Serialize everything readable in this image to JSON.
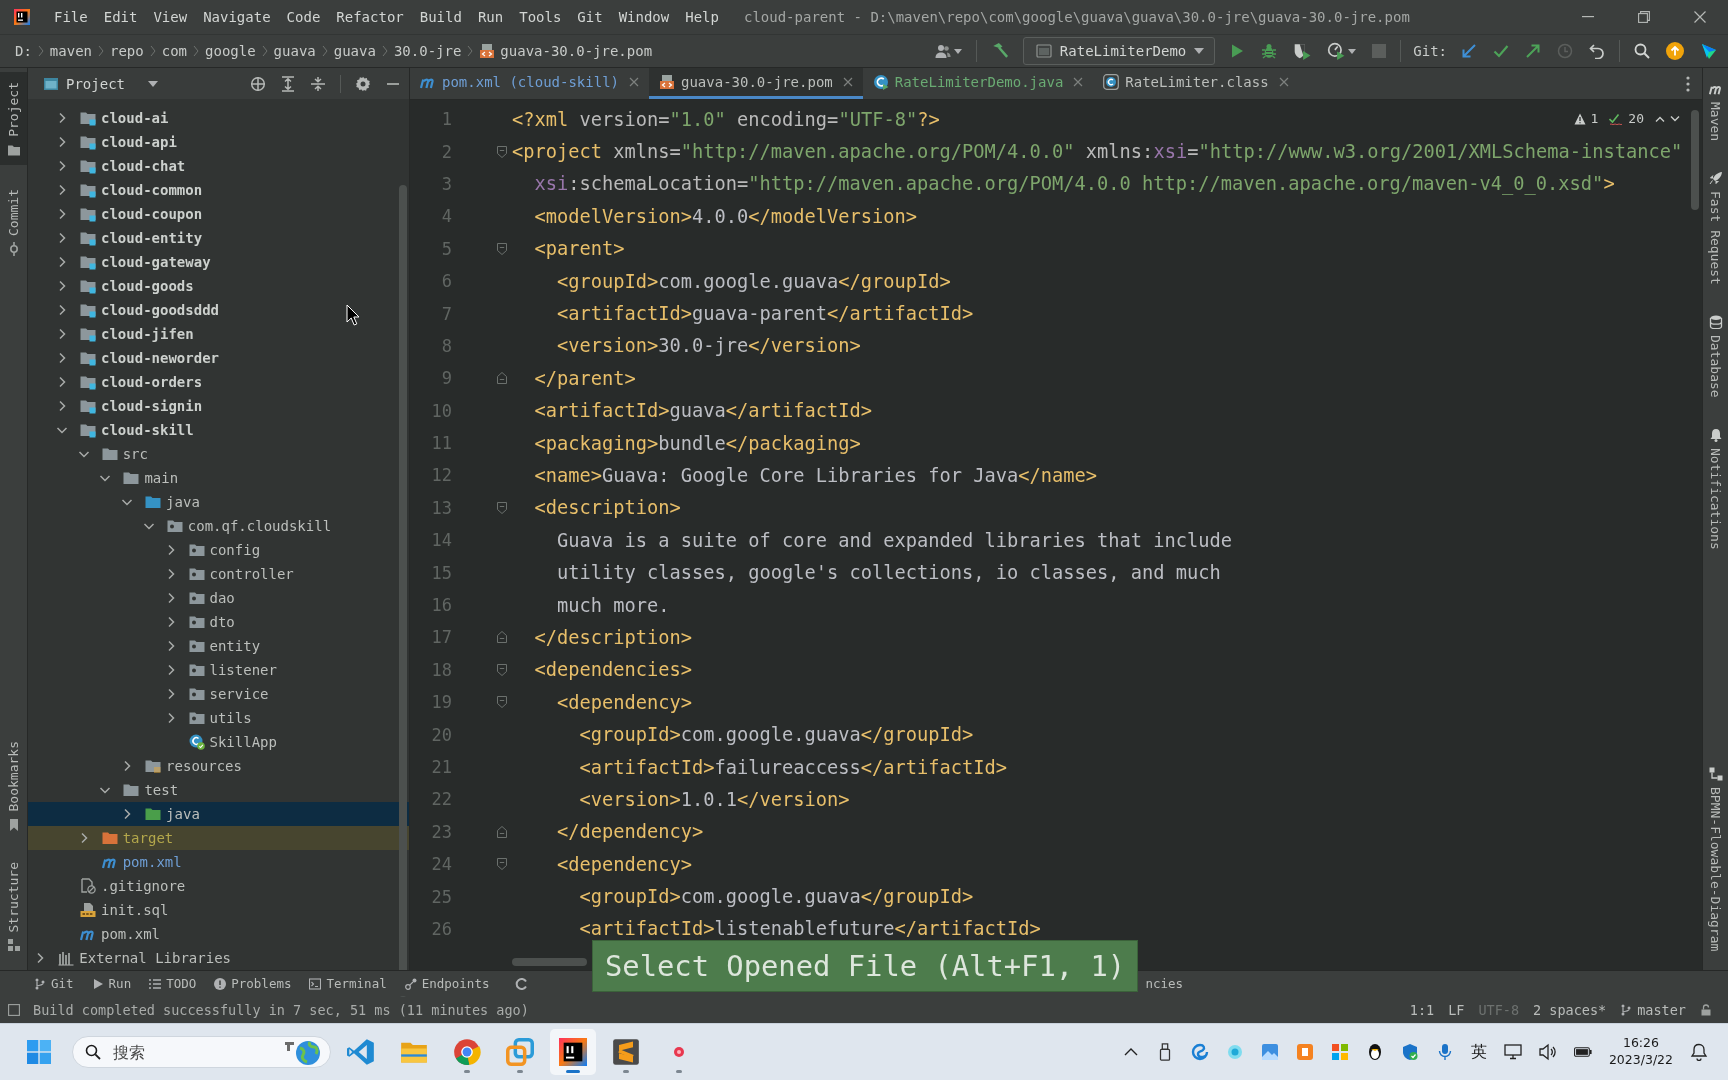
{
  "window": {
    "title": "cloud-parent - D:\\maven\\repo\\com\\google\\guava\\guava\\30.0-jre\\guava-30.0-jre.pom"
  },
  "menu": [
    "File",
    "Edit",
    "View",
    "Navigate",
    "Code",
    "Refactor",
    "Build",
    "Run",
    "Tools",
    "Git",
    "Window",
    "Help"
  ],
  "breadcrumb": [
    "D:",
    "maven",
    "repo",
    "com",
    "google",
    "guava",
    "guava",
    "30.0-jre",
    "guava-30.0-jre.pom"
  ],
  "toolbar": {
    "run_configuration": "RateLimiterDemo",
    "stop": {
      "disabled": true
    },
    "git_label": "Git:",
    "git_history": {
      "disabled": true
    }
  },
  "left_stripe": {
    "top": [
      {
        "label": "Project",
        "selected": true
      },
      {
        "label": "Commit",
        "selected": false
      }
    ],
    "bottom": [
      {
        "label": "Bookmarks",
        "selected": false
      },
      {
        "label": "Structure",
        "selected": false
      }
    ]
  },
  "project_panel": {
    "title": "Project",
    "tree": [
      {
        "label": "cloud-ai",
        "kind": "module",
        "expanded": false,
        "selected": false
      },
      {
        "label": "cloud-api",
        "kind": "module",
        "expanded": false,
        "selected": false
      },
      {
        "label": "cloud-chat",
        "kind": "module",
        "expanded": false,
        "selected": false
      },
      {
        "label": "cloud-common",
        "kind": "module",
        "expanded": false,
        "selected": false
      },
      {
        "label": "cloud-coupon",
        "kind": "module",
        "expanded": false,
        "selected": false
      },
      {
        "label": "cloud-entity",
        "kind": "module",
        "expanded": false,
        "selected": false
      },
      {
        "label": "cloud-gateway",
        "kind": "module",
        "expanded": false,
        "selected": false
      },
      {
        "label": "cloud-goods",
        "kind": "module",
        "expanded": false,
        "selected": false
      },
      {
        "label": "cloud-goodsddd",
        "kind": "module",
        "expanded": false,
        "selected": false
      },
      {
        "label": "cloud-jifen",
        "kind": "module",
        "expanded": false,
        "selected": false
      },
      {
        "label": "cloud-neworder",
        "kind": "module",
        "expanded": false,
        "selected": false
      },
      {
        "label": "cloud-orders",
        "kind": "module",
        "expanded": false,
        "selected": false
      },
      {
        "label": "cloud-signin",
        "kind": "module",
        "expanded": false,
        "selected": false
      },
      {
        "label": "cloud-skill",
        "kind": "module",
        "expanded": true,
        "selected": false,
        "children": [
          {
            "label": "src",
            "kind": "folder",
            "expanded": true,
            "selected": false,
            "children": [
              {
                "label": "main",
                "kind": "folder",
                "expanded": true,
                "selected": false,
                "children": [
                  {
                    "label": "java",
                    "kind": "source",
                    "expanded": true,
                    "selected": false,
                    "children": [
                      {
                        "label": "com.qf.cloudskill",
                        "kind": "package",
                        "expanded": true,
                        "selected": false,
                        "children": [
                          {
                            "label": "config",
                            "kind": "package",
                            "expanded": false,
                            "selected": false
                          },
                          {
                            "label": "controller",
                            "kind": "package",
                            "expanded": false,
                            "selected": false
                          },
                          {
                            "label": "dao",
                            "kind": "package",
                            "expanded": false,
                            "selected": false
                          },
                          {
                            "label": "dto",
                            "kind": "package",
                            "expanded": false,
                            "selected": false
                          },
                          {
                            "label": "entity",
                            "kind": "package",
                            "expanded": false,
                            "selected": false
                          },
                          {
                            "label": "listener",
                            "kind": "package",
                            "expanded": false,
                            "selected": false
                          },
                          {
                            "label": "service",
                            "kind": "package",
                            "expanded": false,
                            "selected": false
                          },
                          {
                            "label": "utils",
                            "kind": "package",
                            "expanded": false,
                            "selected": false
                          },
                          {
                            "label": "SkillApp",
                            "kind": "spring_class",
                            "modified": false,
                            "selected": false
                          }
                        ]
                      }
                    ]
                  },
                  {
                    "label": "resources",
                    "kind": "resources",
                    "expanded": false,
                    "selected": false
                  }
                ]
              },
              {
                "label": "test",
                "kind": "folder",
                "expanded": true,
                "selected": false,
                "children": [
                  {
                    "label": "java",
                    "kind": "test_source",
                    "expanded": false,
                    "selected": true
                  }
                ]
              }
            ]
          },
          {
            "label": "target",
            "kind": "excluded",
            "expanded": false,
            "selected": false
          },
          {
            "label": "pom.xml",
            "kind": "maven",
            "modified": true,
            "selected": false
          }
        ]
      },
      {
        "label": ".gitignore",
        "kind": "ignore",
        "modified": false,
        "selected": false
      },
      {
        "label": "init.sql",
        "kind": "sql",
        "modified": false,
        "selected": false
      },
      {
        "label": "pom.xml",
        "kind": "maven",
        "modified": false,
        "selected": false
      }
    ],
    "outer_items": [
      {
        "label": "External Libraries",
        "kind": "libraries",
        "expanded": false,
        "selected": false
      }
    ]
  },
  "editor_tabs": [
    {
      "label": "pom.xml (cloud-skill)",
      "kind": "maven",
      "modified": true,
      "added": false,
      "selected": false
    },
    {
      "label": "guava-30.0-jre.pom",
      "kind": "xml",
      "modified": false,
      "added": false,
      "selected": true
    },
    {
      "label": "RateLimiterDemo.java",
      "kind": "class",
      "modified": false,
      "added": true,
      "selected": false
    },
    {
      "label": "RateLimiter.class",
      "kind": "compiled",
      "modified": false,
      "added": false,
      "selected": false
    }
  ],
  "editor": {
    "inspections": {
      "warnings": "1",
      "passed": "20"
    },
    "lines": [
      {
        "number": "1",
        "text": "<?xml version=\"1.0\" encoding=\"UTF-8\"?>"
      },
      {
        "number": "2",
        "text": "<project xmlns=\"http://maven.apache.org/POM/4.0.0\" xmlns:xsi=\"http://www.w3.org/2001/XMLSchema-instance\""
      },
      {
        "number": "3",
        "text": "  xsi:schemaLocation=\"http://maven.apache.org/POM/4.0.0 http://maven.apache.org/maven-v4_0_0.xsd\">"
      },
      {
        "number": "4",
        "text": "  <modelVersion>4.0.0</modelVersion>"
      },
      {
        "number": "5",
        "text": "  <parent>"
      },
      {
        "number": "6",
        "text": "    <groupId>com.google.guava</groupId>"
      },
      {
        "number": "7",
        "text": "    <artifactId>guava-parent</artifactId>"
      },
      {
        "number": "8",
        "text": "    <version>30.0-jre</version>"
      },
      {
        "number": "9",
        "text": "  </parent>"
      },
      {
        "number": "10",
        "text": "  <artifactId>guava</artifactId>"
      },
      {
        "number": "11",
        "text": "  <packaging>bundle</packaging>"
      },
      {
        "number": "12",
        "text": "  <name>Guava: Google Core Libraries for Java</name>"
      },
      {
        "number": "13",
        "text": "  <description>"
      },
      {
        "number": "14",
        "text": "    Guava is a suite of core and expanded libraries that include"
      },
      {
        "number": "15",
        "text": "    utility classes, google's collections, io classes, and much"
      },
      {
        "number": "16",
        "text": "    much more."
      },
      {
        "number": "17",
        "text": "  </description>"
      },
      {
        "number": "18",
        "text": "  <dependencies>"
      },
      {
        "number": "19",
        "text": "    <dependency>"
      },
      {
        "number": "20",
        "text": "      <groupId>com.google.guava</groupId>"
      },
      {
        "number": "21",
        "text": "      <artifactId>failureaccess</artifactId>"
      },
      {
        "number": "22",
        "text": "      <version>1.0.1</version>"
      },
      {
        "number": "23",
        "text": "    </dependency>"
      },
      {
        "number": "24",
        "text": "    <dependency>"
      },
      {
        "number": "25",
        "text": "      <groupId>com.google.guava</groupId>"
      },
      {
        "number": "26",
        "text": "      <artifactId>listenablefuture</artifactId>"
      }
    ]
  },
  "right_stripe": {
    "top": [
      "Maven",
      "Fast Request",
      "Database",
      "Notifications"
    ],
    "bottom": [
      "BPMN-Flowable-Diagram"
    ]
  },
  "popup": {
    "text": "Select Opened File (Alt+F1, 1)"
  },
  "bottom_tools": {
    "items": [
      "Git",
      "Run",
      "TODO",
      "Problems",
      "Terminal",
      "Endpoints"
    ],
    "covered_tail": "ncies"
  },
  "status_bar": {
    "message": "Build completed successfully in 7 sec, 51 ms (11 minutes ago)",
    "widgets": [
      {
        "text": "1:1",
        "disabled": false
      },
      {
        "text": "LF",
        "disabled": false
      },
      {
        "text": "UTF-8",
        "disabled": true
      },
      {
        "text": "2 spaces*",
        "disabled": false
      }
    ],
    "branch": "master"
  },
  "taskbar": {
    "search": {
      "placeholder": "搜索"
    },
    "apps": [
      {
        "running": false,
        "active": false
      },
      {
        "running": false,
        "active": false
      },
      {
        "running": true,
        "active": false
      },
      {
        "running": true,
        "active": false
      },
      {
        "running": true,
        "active": true
      },
      {
        "running": true,
        "active": false
      },
      {
        "running": true,
        "active": false
      }
    ],
    "input_method": "英",
    "time": "16:26",
    "date": "2023/3/22"
  }
}
